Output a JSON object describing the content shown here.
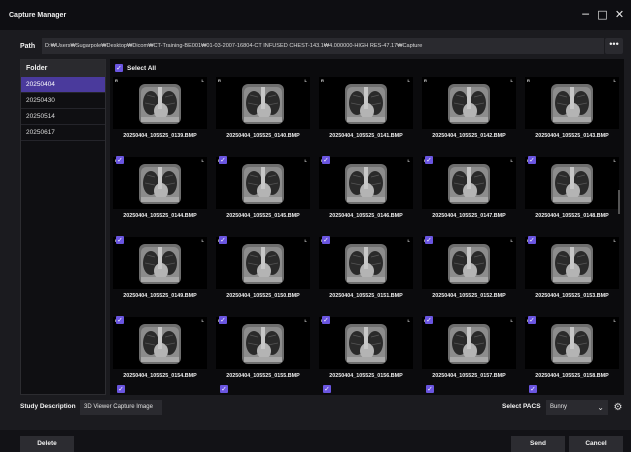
{
  "window": {
    "title": "Capture Manager",
    "controls": {
      "minimize": "─",
      "maximize": "□",
      "close": "✕"
    }
  },
  "path": {
    "label": "Path",
    "value": "D:₩Users₩Sugarpole₩Desktop₩Dicom₩CT-Training-BE001₩01-03-2007-16804-CT INFUSED CHEST-143.1₩4.000000-HIGH RES-47.17₩Capture",
    "more_icon": "more-horizontal-icon",
    "more_label": "•••"
  },
  "folders": {
    "header": "Folder",
    "items": [
      "20250404",
      "20250430",
      "20250514",
      "20250617"
    ],
    "selected_index": 0
  },
  "grid": {
    "select_all_label": "Select All",
    "select_all_checked": true,
    "orientation_left": "R",
    "orientation_right": "L",
    "checkmark": "✓",
    "tiles": [
      {
        "file": "20250404_105525_0139.BMP",
        "checked": false
      },
      {
        "file": "20250404_105525_0140.BMP",
        "checked": false
      },
      {
        "file": "20250404_105525_0141.BMP",
        "checked": false
      },
      {
        "file": "20250404_105525_0142.BMP",
        "checked": false
      },
      {
        "file": "20250404_105525_0143.BMP",
        "checked": false
      },
      {
        "file": "20250404_105525_0144.BMP",
        "checked": true
      },
      {
        "file": "20250404_105525_0145.BMP",
        "checked": true
      },
      {
        "file": "20250404_105525_0146.BMP",
        "checked": true
      },
      {
        "file": "20250404_105525_0147.BMP",
        "checked": true
      },
      {
        "file": "20250404_105525_0148.BMP",
        "checked": true
      },
      {
        "file": "20250404_105525_0149.BMP",
        "checked": true
      },
      {
        "file": "20250404_105525_0150.BMP",
        "checked": true
      },
      {
        "file": "20250404_105525_0151.BMP",
        "checked": true
      },
      {
        "file": "20250404_105525_0152.BMP",
        "checked": true
      },
      {
        "file": "20250404_105525_0153.BMP",
        "checked": true
      },
      {
        "file": "20250404_105525_0154.BMP",
        "checked": true
      },
      {
        "file": "20250404_105525_0155.BMP",
        "checked": true
      },
      {
        "file": "20250404_105525_0156.BMP",
        "checked": true
      },
      {
        "file": "20250404_105525_0157.BMP",
        "checked": true
      },
      {
        "file": "20250404_105525_0158.BMP",
        "checked": true
      }
    ],
    "next_row_checked": [
      true,
      true,
      true,
      true,
      true
    ]
  },
  "study": {
    "label": "Study Description",
    "value": "3D Viewer Capture Image"
  },
  "pacs": {
    "label": "Select PACS",
    "selected": "Bunny",
    "settings_icon": "gear-icon",
    "settings_glyph": "⚙",
    "chevron_glyph": "⌄"
  },
  "footer": {
    "delete_label": "Delete",
    "send_label": "Send",
    "cancel_label": "Cancel"
  },
  "colors": {
    "accent": "#6a55e0",
    "selected_folder": "#4a3a9c",
    "background": "#1b1b1f",
    "titlebar": "#0e0e12"
  }
}
